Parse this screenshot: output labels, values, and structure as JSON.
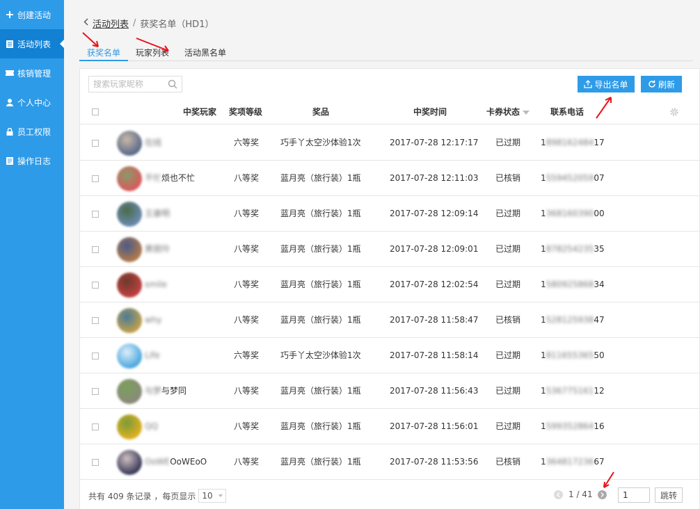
{
  "sidebar": {
    "items": [
      {
        "label": "创建活动",
        "icon": "plus-icon",
        "active": false
      },
      {
        "label": "活动列表",
        "icon": "document-icon",
        "active": true
      },
      {
        "label": "核销管理",
        "icon": "ticket-icon",
        "active": false
      },
      {
        "label": "个人中心",
        "icon": "user-icon",
        "active": false
      },
      {
        "label": "员工权限",
        "icon": "lock-icon",
        "active": false
      },
      {
        "label": "操作日志",
        "icon": "log-icon",
        "active": false
      }
    ]
  },
  "breadcrumb": {
    "back_link": "活动列表",
    "separator": "/",
    "current": "获奖名单（HD1）"
  },
  "tabs": [
    {
      "label": "获奖名单",
      "active": true
    },
    {
      "label": "玩家列表",
      "active": false
    },
    {
      "label": "活动黑名单",
      "active": false
    }
  ],
  "toolbar": {
    "search_placeholder": "搜索玩家昵称",
    "export_label": "导出名单",
    "refresh_label": "刷新"
  },
  "table": {
    "headers": {
      "winner": "中奖玩家",
      "level": "奖项等级",
      "prize": "奖品",
      "time": "中奖时间",
      "status": "卡券状态",
      "phone": "联系电话"
    },
    "rows": [
      {
        "nick": "在线",
        "nick_visible": "",
        "level": "六等奖",
        "prize": "巧手丫太空沙体验1次",
        "time": "2017-07-28 12:17:17",
        "status": "已过期",
        "phone_prefix": "1",
        "phone_blur": "898162484",
        "phone_suffix": "17"
      },
      {
        "nick": "不忙",
        "nick_visible": "烦也不忙",
        "level": "八等奖",
        "prize": "蓝月亮（旅行装）1瓶",
        "time": "2017-07-28 12:11:03",
        "status": "已核销",
        "phone_prefix": "1",
        "phone_blur": "559452059",
        "phone_suffix": "07"
      },
      {
        "nick": "王康明",
        "nick_visible": "",
        "level": "八等奖",
        "prize": "蓝月亮（旅行装）1瓶",
        "time": "2017-07-28 12:09:14",
        "status": "已过期",
        "phone_prefix": "1",
        "phone_blur": "368160390",
        "phone_suffix": "00"
      },
      {
        "nick": "黄丽玲",
        "nick_visible": "",
        "level": "八等奖",
        "prize": "蓝月亮（旅行装）1瓶",
        "time": "2017-07-28 12:09:01",
        "status": "已过期",
        "phone_prefix": "1",
        "phone_blur": "878254235",
        "phone_suffix": "35"
      },
      {
        "nick": "smile",
        "nick_visible": "",
        "level": "八等奖",
        "prize": "蓝月亮（旅行装）1瓶",
        "time": "2017-07-28 12:02:54",
        "status": "已过期",
        "phone_prefix": "1",
        "phone_blur": "580925868",
        "phone_suffix": "34"
      },
      {
        "nick": "why",
        "nick_visible": "",
        "level": "八等奖",
        "prize": "蓝月亮（旅行装）1瓶",
        "time": "2017-07-28 11:58:47",
        "status": "已核销",
        "phone_prefix": "1",
        "phone_blur": "528125938",
        "phone_suffix": "47"
      },
      {
        "nick": "Life",
        "nick_visible": "",
        "level": "六等奖",
        "prize": "巧手丫太空沙体验1次",
        "time": "2017-07-28 11:58:14",
        "status": "已过期",
        "phone_prefix": "1",
        "phone_blur": "811655365",
        "phone_suffix": "50"
      },
      {
        "nick": "与梦",
        "nick_visible": "与梦同",
        "level": "八等奖",
        "prize": "蓝月亮（旅行装）1瓶",
        "time": "2017-07-28 11:56:43",
        "status": "已过期",
        "phone_prefix": "1",
        "phone_blur": "536775161",
        "phone_suffix": "12"
      },
      {
        "nick": "QQ",
        "nick_visible": "",
        "level": "八等奖",
        "prize": "蓝月亮（旅行装）1瓶",
        "time": "2017-07-28 11:56:01",
        "status": "已过期",
        "phone_prefix": "1",
        "phone_blur": "599352864",
        "phone_suffix": "16"
      },
      {
        "nick": "OoWE",
        "nick_visible": "OoWEoO",
        "level": "八等奖",
        "prize": "蓝月亮（旅行装）1瓶",
        "time": "2017-07-28 11:53:56",
        "status": "已核销",
        "phone_prefix": "1",
        "phone_blur": "364817236",
        "phone_suffix": "67"
      }
    ]
  },
  "footer": {
    "total_text": "共有 409 条记录 ，每页显示",
    "page_size": "10",
    "page_text": "1 / 41",
    "page_input": "1",
    "go_label": "跳转"
  },
  "colors": {
    "accent": "#2d9be8",
    "sidebar_active": "#1281d4",
    "arrow": "#e8121a"
  }
}
